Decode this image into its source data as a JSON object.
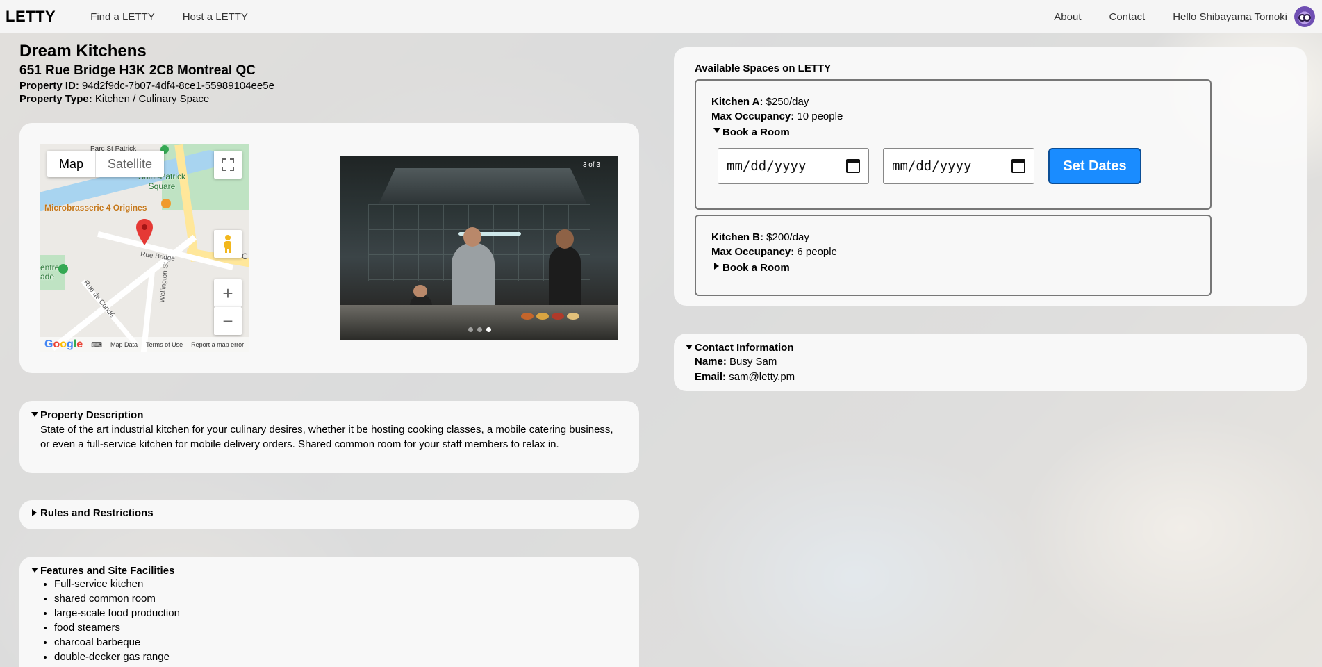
{
  "nav": {
    "brand": "LETTY",
    "links": [
      "Find a LETTY",
      "Host a LETTY"
    ],
    "right_links": [
      "About",
      "Contact"
    ],
    "greeting": "Hello Shibayama Tomoki"
  },
  "property": {
    "title": "Dream Kitchens",
    "address": "651 Rue Bridge H3K 2C8 Montreal QC",
    "id_label": "Property ID:",
    "id_value": "94d2f9dc-7b07-4df4-8ce1-55989104ee5e",
    "type_label": "Property Type:",
    "type_value": "Kitchen / Culinary Space"
  },
  "map": {
    "toggle_map": "Map",
    "toggle_satellite": "Satellite",
    "labels": {
      "street_top": "Parc St Patrick",
      "park": "Saint-Patrick Square",
      "business": "Microbrasserie 4 Origines",
      "rue_bridge": "Rue Bridge",
      "wellington": "Wellington St",
      "rue_conde": "Rue de Condé",
      "centre": "entre ade",
      "cut": "C"
    },
    "footer": [
      "Map Data",
      "Terms of Use",
      "Report a map error"
    ],
    "zoom_in": "+",
    "zoom_out": "−"
  },
  "carousel": {
    "counter": "3 of 3",
    "total": 3,
    "current": 3
  },
  "description": {
    "heading": "Property Description",
    "text": "State of the art industrial kitchen for your culinary desires, whether it be hosting cooking classes, a mobile catering business, or even a full-service kitchen for mobile delivery orders. Shared common room for your staff members to relax in."
  },
  "rules": {
    "heading": "Rules and Restrictions"
  },
  "features": {
    "heading": "Features and Site Facilities",
    "items": [
      "Full-service kitchen",
      "shared common room",
      "large-scale food production",
      "food steamers",
      "charcoal barbeque",
      "double-decker gas range"
    ]
  },
  "spaces": {
    "title": "Available Spaces on LETTY",
    "kitchens": [
      {
        "name_label": "Kitchen A:",
        "price": "$250/day",
        "occupancy_label": "Max Occupancy:",
        "occupancy": "10 people",
        "book_label": "Book a Room",
        "expanded": true
      },
      {
        "name_label": "Kitchen B:",
        "price": "$200/day",
        "occupancy_label": "Max Occupancy:",
        "occupancy": "6 people",
        "book_label": "Book a Room",
        "expanded": false
      }
    ],
    "date_placeholder": "mm/dd/yyyy",
    "set_dates": "Set Dates"
  },
  "contact": {
    "heading": "Contact Information",
    "name_label": "Name:",
    "name": "Busy Sam",
    "email_label": "Email:",
    "email": "sam@letty.pm"
  },
  "colors": {
    "primary_button": "#1a8cff",
    "map_pin": "#e53935"
  }
}
